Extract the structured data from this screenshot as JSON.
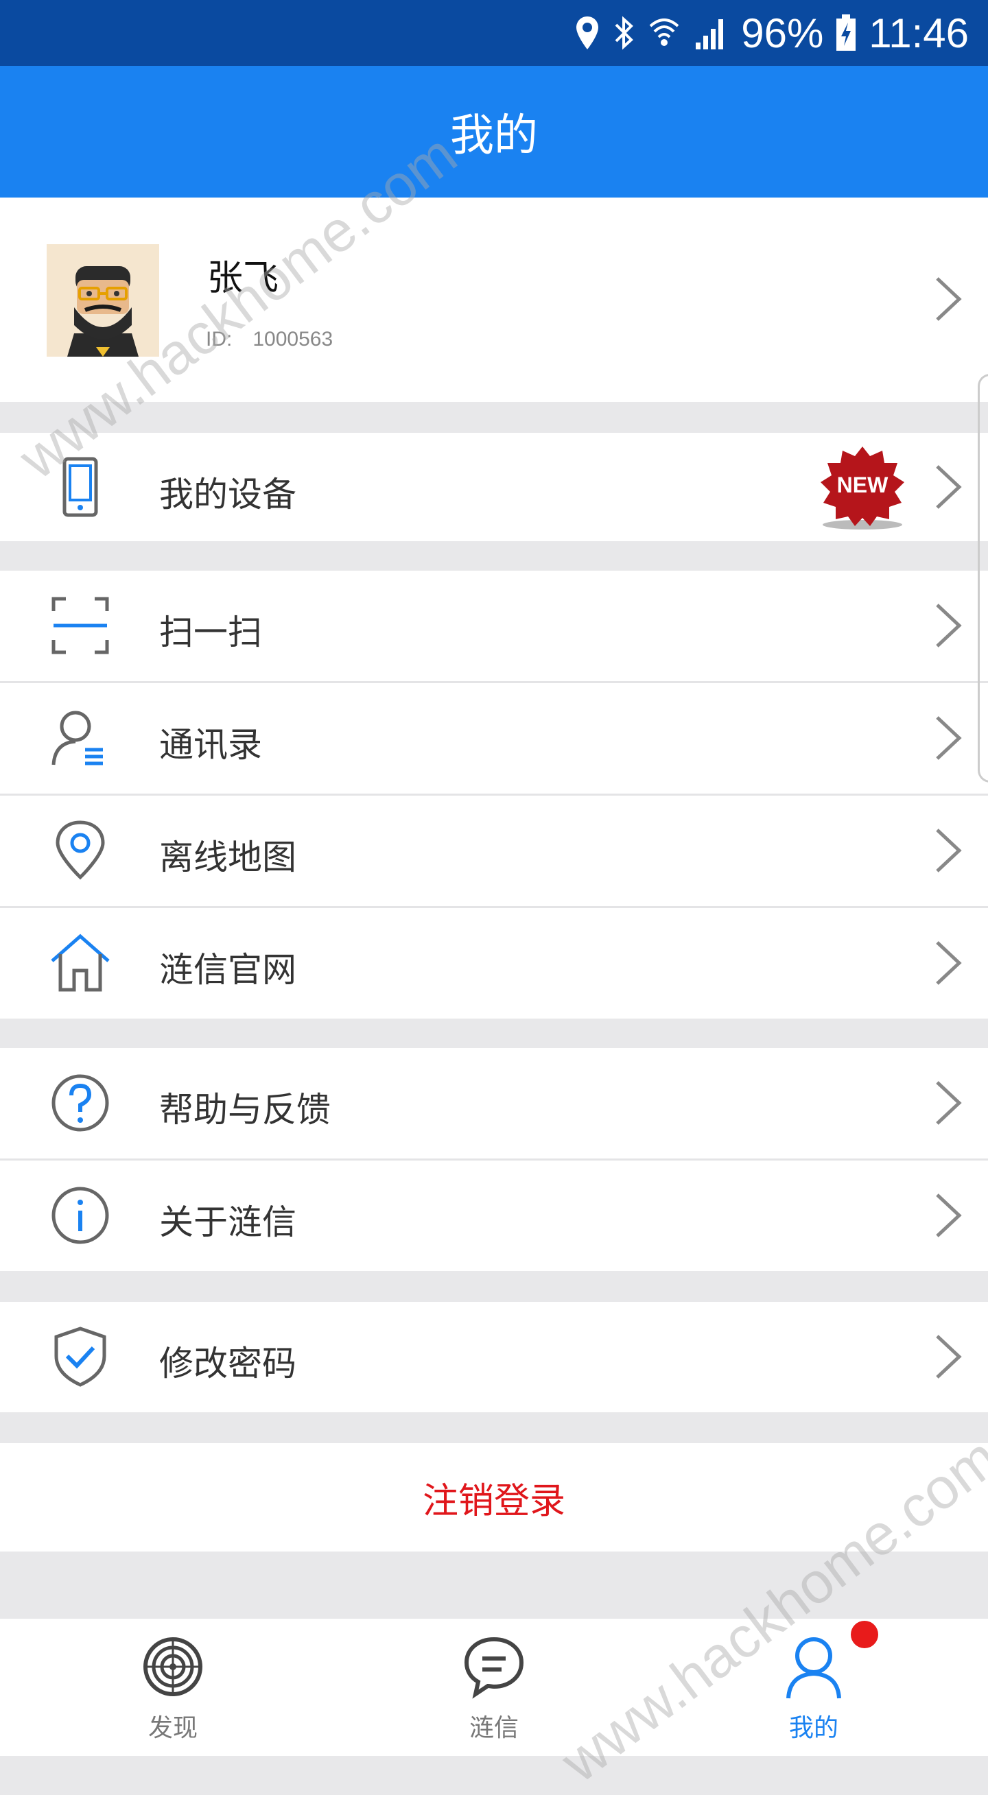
{
  "status_bar": {
    "battery": "96%",
    "time": "11:46"
  },
  "header": {
    "title": "我的"
  },
  "profile": {
    "name": "张飞",
    "id_label": "ID:",
    "id_value": "1000563"
  },
  "menu": {
    "my_device": {
      "label": "我的设备",
      "badge": "NEW"
    },
    "scan": {
      "label": "扫一扫"
    },
    "contacts": {
      "label": "通讯录"
    },
    "offline_map": {
      "label": "离线地图"
    },
    "website": {
      "label": "涟信官网"
    },
    "help": {
      "label": "帮助与反馈"
    },
    "about": {
      "label": "关于涟信"
    },
    "change_password": {
      "label": "修改密码"
    }
  },
  "logout": {
    "label": "注销登录"
  },
  "bottom_nav": [
    {
      "label": "发现",
      "icon": "target-icon"
    },
    {
      "label": "涟信",
      "icon": "chat-bubble-icon"
    },
    {
      "label": "我的",
      "icon": "person-icon",
      "active": true
    }
  ],
  "watermark": "www.hackhome.com",
  "colors": {
    "header": "#1a82f1",
    "status_bar": "#0a4aa0",
    "logout": "#e0161b",
    "active_tab": "#1a82f1",
    "badge": "#e81b1b"
  }
}
